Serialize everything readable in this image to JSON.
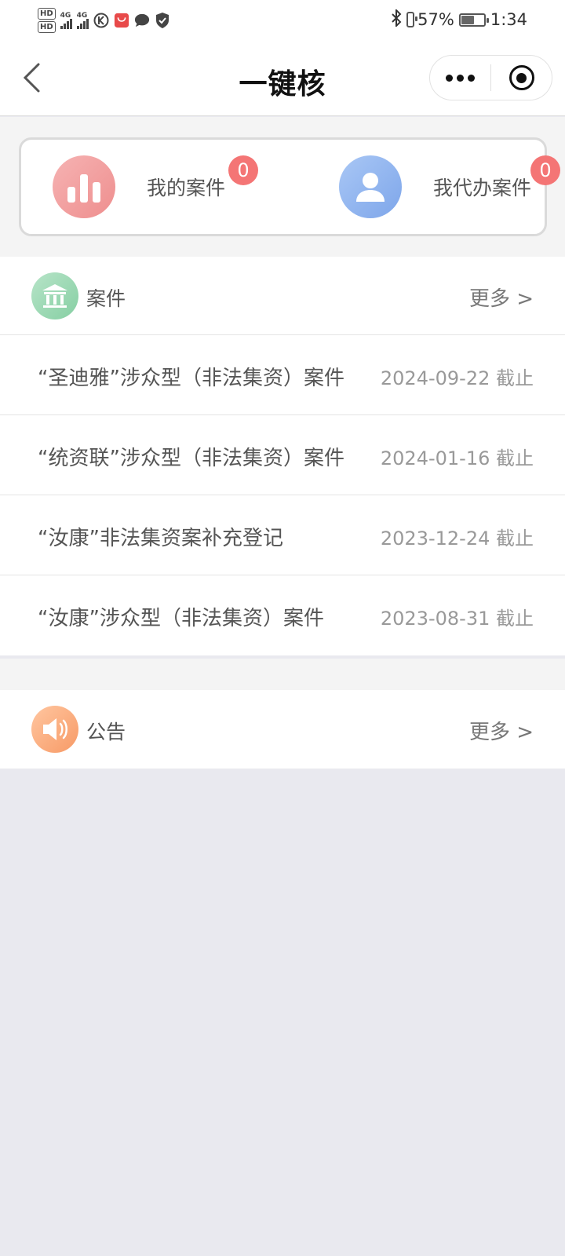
{
  "status_bar": {
    "hd1": "HD",
    "hd2": "HD",
    "net1": "4G",
    "net2": "4G",
    "battery_percent": "57%",
    "battery_level": 0.57,
    "time": "1:34",
    "icons": [
      "signal-icon",
      "k-app-icon",
      "shopping-app-icon",
      "message-icon",
      "shield-icon",
      "bluetooth-icon",
      "battery-icon"
    ]
  },
  "nav": {
    "title": "一键核",
    "back_icon": "chevron-left-icon",
    "menu_icon": "more-dots-icon",
    "close_icon": "target-icon"
  },
  "quick": {
    "items": [
      {
        "label": "我的案件",
        "badge": "0",
        "icon": "bar-chart-icon",
        "color": "#ee8e8e"
      },
      {
        "label": "我代办案件",
        "badge": "0",
        "icon": "user-icon",
        "color": "#7ea6ea"
      }
    ]
  },
  "cases": {
    "title": "案件",
    "more": "更多 >",
    "icon": "bank-icon",
    "rows": [
      {
        "title": "“圣迪雅”涉众型（非法集资）案件",
        "date": "2024-09-22 截止"
      },
      {
        "title": "“统资联”涉众型（非法集资）案件",
        "date": "2024-01-16 截止"
      },
      {
        "title": "“汝康”非法集资案补充登记",
        "date": "2023-12-24 截止"
      },
      {
        "title": "“汝康”涉众型（非法集资）案件",
        "date": "2023-08-31 截止"
      }
    ]
  },
  "notices": {
    "title": "公告",
    "more": "更多 >",
    "icon": "speaker-icon"
  },
  "colors": {
    "badge": "#f47575",
    "page_bg": "#e9e9ef",
    "green_icon": "#86cfa3",
    "orange_icon": "#f79a66"
  }
}
